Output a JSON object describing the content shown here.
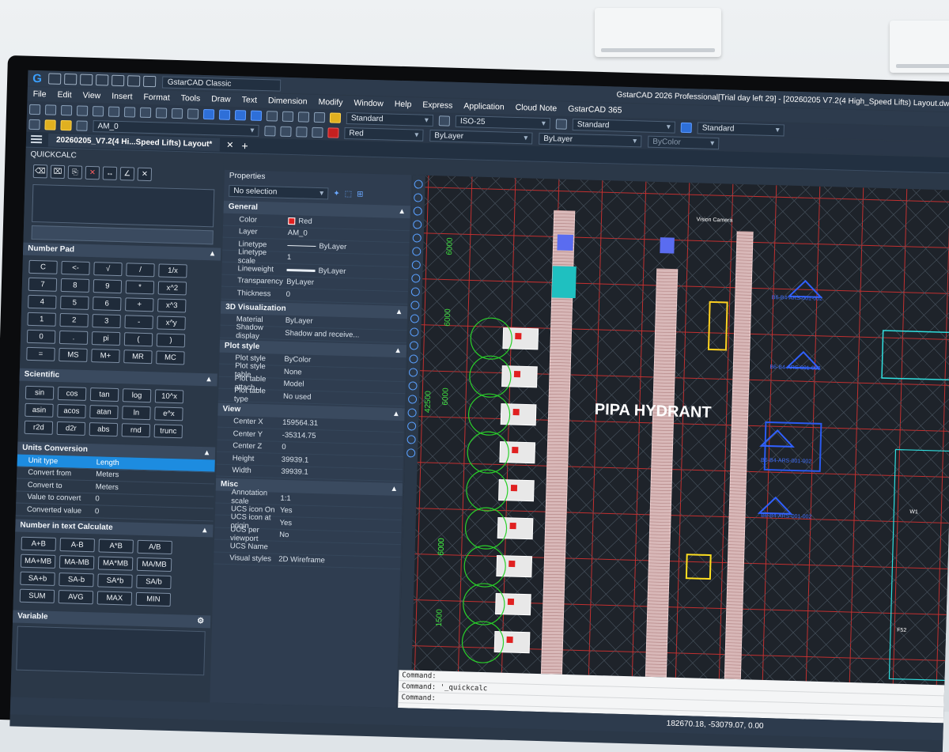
{
  "app": {
    "workspace": "GstarCAD Classic",
    "title": "GstarCAD 2026 Professional[Trial day left 29] - [20260205 V7.2(4 High_Speed Lifts) Layout.dwg]"
  },
  "menu": [
    "File",
    "Edit",
    "View",
    "Insert",
    "Format",
    "Tools",
    "Draw",
    "Text",
    "Dimension",
    "Modify",
    "Window",
    "Help",
    "Express",
    "Application",
    "Cloud Note",
    "GstarCAD 365"
  ],
  "toolbar": {
    "layer": "AM_0",
    "text_style": "Standard",
    "dim_style": "ISO-25",
    "table_style": "Standard",
    "mleader_style": "Standard",
    "color": "Red",
    "linetype": "ByLayer",
    "lineweight": "ByLayer",
    "plotstyle": "ByColor"
  },
  "doc_tab": "20260205_V7.2(4 Hi...Speed Lifts) Layout*",
  "quickcalc": {
    "title": "QUICKCALC",
    "number_pad": {
      "title": "Number Pad",
      "keys": [
        "C",
        "<-",
        "√",
        "/",
        "1/x",
        "7",
        "8",
        "9",
        "*",
        "x^2",
        "4",
        "5",
        "6",
        "+",
        "x^3",
        "1",
        "2",
        "3",
        "-",
        "x^y",
        "0",
        ".",
        "pi",
        "(",
        ")",
        "=",
        "MS",
        "M+",
        "MR",
        "MC"
      ]
    },
    "scientific": {
      "title": "Scientific",
      "keys": [
        "sin",
        "cos",
        "tan",
        "log",
        "10^x",
        "asin",
        "acos",
        "atan",
        "ln",
        "e^x",
        "r2d",
        "d2r",
        "abs",
        "rnd",
        "trunc"
      ]
    },
    "units": {
      "title": "Units Conversion",
      "rows": [
        {
          "k": "Unit type",
          "v": "Length"
        },
        {
          "k": "Convert from",
          "v": "Meters"
        },
        {
          "k": "Convert to",
          "v": "Meters"
        },
        {
          "k": "Value to convert",
          "v": "0"
        },
        {
          "k": "Converted value",
          "v": "0"
        }
      ]
    },
    "text_calc": {
      "title": "Number in text Calculate",
      "keys": [
        "A+B",
        "A-B",
        "A*B",
        "A/B",
        "MA+MB",
        "MA-MB",
        "MA*MB",
        "MA/MB",
        "SA+b",
        "SA-b",
        "SA*b",
        "SA/b",
        "SUM",
        "AVG",
        "MAX",
        "MIN"
      ]
    },
    "variable": {
      "title": "Variable"
    }
  },
  "properties": {
    "title": "Properties",
    "selection": "No selection",
    "sections": [
      {
        "name": "General",
        "rows": [
          {
            "k": "Color",
            "v": "Red"
          },
          {
            "k": "Layer",
            "v": "AM_0"
          },
          {
            "k": "Linetype",
            "v": "ByLayer"
          },
          {
            "k": "Linetype scale",
            "v": "1"
          },
          {
            "k": "Lineweight",
            "v": "ByLayer"
          },
          {
            "k": "Transparency",
            "v": "ByLayer"
          },
          {
            "k": "Thickness",
            "v": "0"
          }
        ]
      },
      {
        "name": "3D Visualization",
        "rows": [
          {
            "k": "Material",
            "v": "ByLayer"
          },
          {
            "k": "Shadow display",
            "v": "Shadow and receive..."
          }
        ]
      },
      {
        "name": "Plot style",
        "rows": [
          {
            "k": "Plot style",
            "v": "ByColor"
          },
          {
            "k": "Plot style table",
            "v": "None"
          },
          {
            "k": "Plot table attach...",
            "v": "Model"
          },
          {
            "k": "Plot table type",
            "v": "No used"
          }
        ]
      },
      {
        "name": "View",
        "rows": [
          {
            "k": "Center X",
            "v": "159564.31"
          },
          {
            "k": "Center Y",
            "v": "-35314.75"
          },
          {
            "k": "Center Z",
            "v": "0"
          },
          {
            "k": "Height",
            "v": "39939.1"
          },
          {
            "k": "Width",
            "v": "39939.1"
          }
        ]
      },
      {
        "name": "Misc",
        "rows": [
          {
            "k": "Annotation scale",
            "v": "1:1"
          },
          {
            "k": "UCS icon On",
            "v": "Yes"
          },
          {
            "k": "UCS icon at origin",
            "v": "Yes"
          },
          {
            "k": "UCS per viewport",
            "v": "No"
          },
          {
            "k": "UCS Name",
            "v": ""
          },
          {
            "k": "Visual styles",
            "v": "2D Wireframe"
          }
        ]
      }
    ]
  },
  "drawing": {
    "label_main": "PIPA HYDRANT",
    "dims": [
      "6000",
      "6000",
      "42500",
      "6000",
      "6000",
      "6000",
      "1500"
    ],
    "tags": [
      "B6-B4-ARS-001-002",
      "B6-B4-ARS-001-002",
      "B6-B4-ARS-001-002",
      "B6-B4-ARS-001-002",
      "Vision Camera",
      "F52",
      "W1"
    ]
  },
  "command": {
    "lines": [
      "Command:",
      "Command: '_quickcalc",
      "Command:"
    ]
  },
  "status": {
    "coords": "182670.18, -53079.07, 0.00"
  }
}
